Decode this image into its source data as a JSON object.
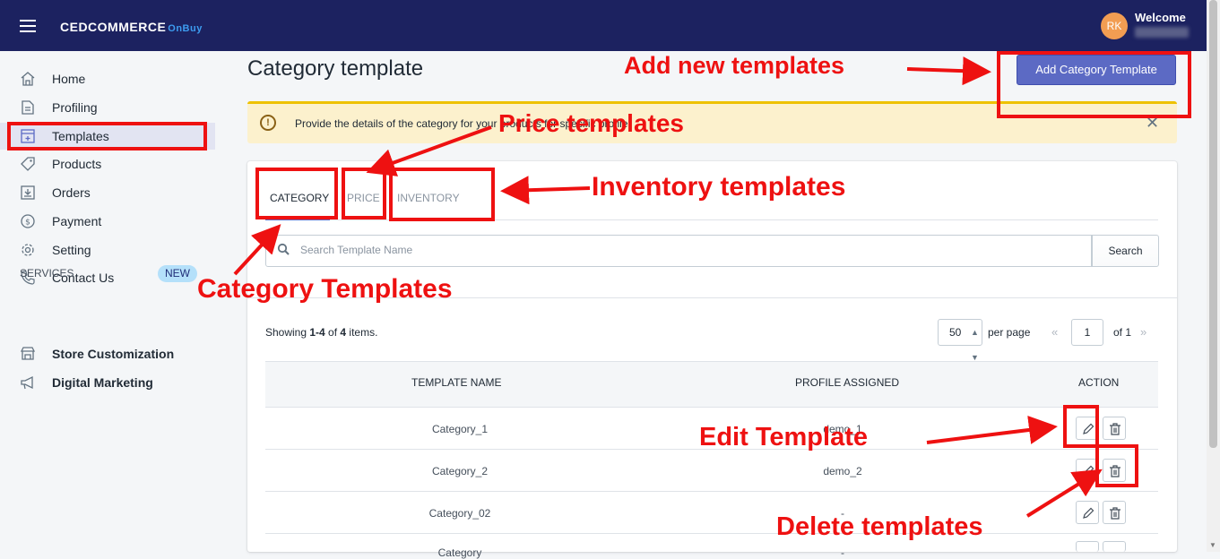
{
  "header": {
    "logo_main": "CEDCOMMERCE",
    "logo_sub": "OnBuy",
    "avatar_initials": "RK",
    "welcome": "Welcome"
  },
  "sidebar": {
    "items": [
      {
        "label": "Home",
        "icon": "home-icon"
      },
      {
        "label": "Profiling",
        "icon": "profiling-icon"
      },
      {
        "label": "Templates",
        "icon": "templates-icon"
      },
      {
        "label": "Products",
        "icon": "tag-icon"
      },
      {
        "label": "Orders",
        "icon": "orders-icon"
      },
      {
        "label": "Payment",
        "icon": "dollar-icon"
      },
      {
        "label": "Setting",
        "icon": "gear-icon"
      },
      {
        "label": "Contact Us",
        "icon": "phone-icon"
      }
    ],
    "services_label": "SERVICES",
    "new_badge": "NEW",
    "services": [
      {
        "label": "Store Customization",
        "icon": "store-icon"
      },
      {
        "label": "Digital Marketing",
        "icon": "megaphone-icon"
      }
    ]
  },
  "main": {
    "title": "Category template",
    "add_button": "Add Category Template",
    "banner_message": "Provide the details of the category for your products for specific profile.",
    "tabs": [
      {
        "label": "CATEGORY",
        "active": true
      },
      {
        "label": "PRICE",
        "active": false
      },
      {
        "label": "INVENTORY",
        "active": false
      }
    ],
    "search_placeholder": "Search Template Name",
    "search_button": "Search",
    "showing_prefix": "Showing ",
    "showing_range": "1-4",
    "showing_mid": " of ",
    "showing_total": "4",
    "showing_suffix": " items.",
    "per_page_value": "50",
    "per_page_label": "per page",
    "page_prev": "«",
    "current_page": "1",
    "page_of": "of 1",
    "page_next": "»",
    "table": {
      "headers": [
        "TEMPLATE NAME",
        "PROFILE ASSIGNED",
        "ACTION"
      ],
      "rows": [
        {
          "name": "Category_1",
          "profile": "demo_1"
        },
        {
          "name": "Category_2",
          "profile": "demo_2"
        },
        {
          "name": "Category_02",
          "profile": "-"
        },
        {
          "name": "Category",
          "profile": "-"
        }
      ]
    }
  },
  "annotations": {
    "add_new": "Add new templates",
    "price": "Price templates",
    "inventory": "Inventory templates",
    "category": "Category Templates",
    "edit": "Edit Template",
    "delete": "Delete templates"
  },
  "colors": {
    "topbar": "#1c2260",
    "primary": "#5c6ac4",
    "annotation_red": "#ee1111",
    "banner_bg": "#fcf1cd"
  }
}
